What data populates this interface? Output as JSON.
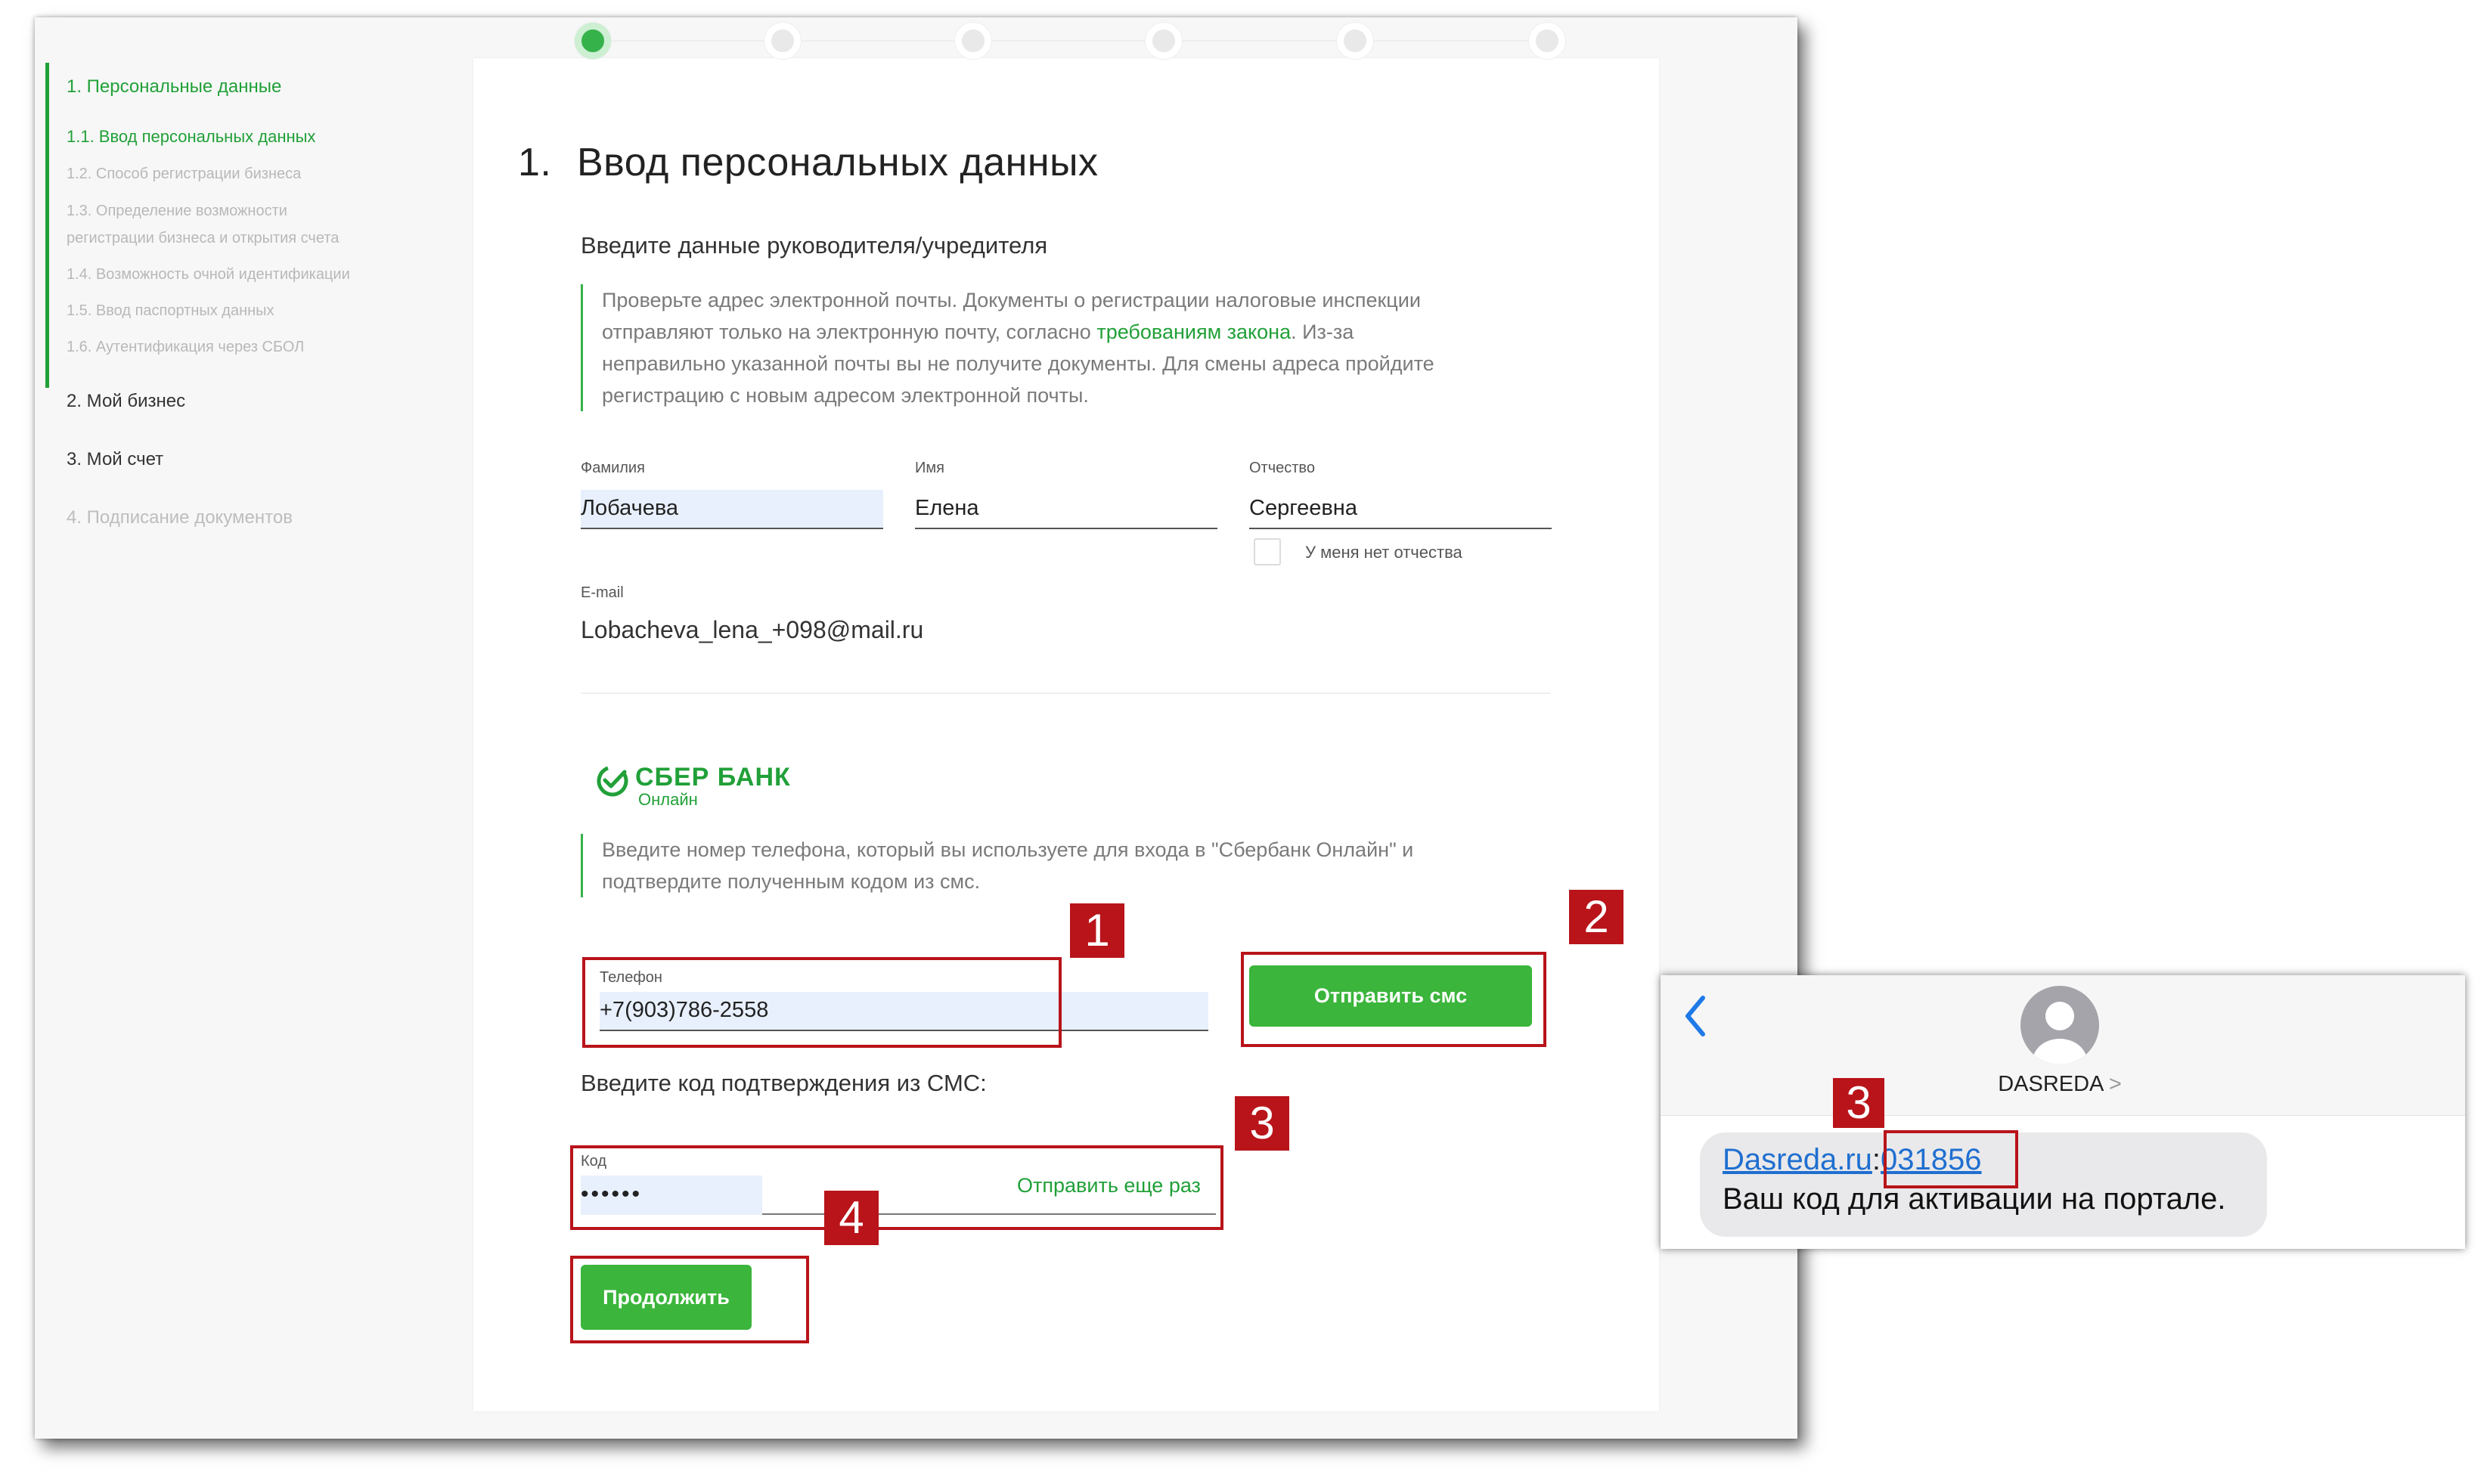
{
  "sidebar": {
    "items": [
      {
        "label": "1. Персональные данные"
      },
      {
        "label": "1.1. Ввод персональных данных"
      },
      {
        "label": "1.2. Способ регистрации бизнеса"
      },
      {
        "label": "1.3. Определение возможности"
      },
      {
        "label": "регистрации бизнеса и открытия счета"
      },
      {
        "label": "1.4. Возможность очной идентификации"
      },
      {
        "label": "1.5. Ввод паспортных данных"
      },
      {
        "label": "1.6. Аутентификация через СБОЛ"
      },
      {
        "label": "2. Мой бизнес"
      },
      {
        "label": "3. Мой счет"
      },
      {
        "label": "4. Подписание документов"
      }
    ]
  },
  "form": {
    "title_number": "1.",
    "title": "Ввод персональных данных",
    "subtitle": "Введите данные руководителя/учредителя",
    "email_notice": {
      "part1": "Проверьте адрес электронной почты. Документы о регистрации налоговые инспекции",
      "part2": "отправляют только на электронную почту, согласно ",
      "link": "требованиям закона",
      "part3": ". Из-за",
      "part4": "неправильно указанной почты вы не получите документы. Для смены адреса пройдите",
      "part5": "регистрацию с новым адресом электронной почты."
    },
    "last_name": {
      "label": "Фамилия",
      "value": "Лобачева"
    },
    "first_name": {
      "label": "Имя",
      "value": "Елена"
    },
    "middle_name": {
      "label": "Отчество",
      "value": "Сергеевна"
    },
    "no_middle_name_label": "У меня нет отчества",
    "email": {
      "label": "E-mail",
      "value": "Lobacheva_lena_+098@mail.ru"
    },
    "sber": {
      "brand": "СБЕР БАНК",
      "sub": "Онлайн"
    },
    "phone_notice": {
      "line1": "Введите номер телефона, который вы используете для входа в \"Сбербанк Онлайн\" и",
      "line2": "подтвердите полученным кодом из смс."
    },
    "phone": {
      "label": "Телефон",
      "value": "+7(903)786-2558"
    },
    "send_sms_button": "Отправить смс",
    "sms_heading": "Введите код подтверждения из СМС:",
    "code": {
      "label": "Код",
      "value": "••••••"
    },
    "resend_link": "Отправить еще раз",
    "continue_button": "Продолжить"
  },
  "annotations": {
    "badges": [
      "1",
      "2",
      "3",
      "4",
      "3"
    ]
  },
  "sms": {
    "contact": "DASREDA",
    "chevron": ">",
    "sender_link": "Dasreda.ru",
    "separator": ":",
    "code": "031856",
    "message": "Ваш код для активации на портале."
  },
  "colors": {
    "accent_green": "#21a038",
    "button_green": "#3bb53b",
    "annotation_red": "#b8141a",
    "ios_link_blue": "#1f6fd0"
  }
}
